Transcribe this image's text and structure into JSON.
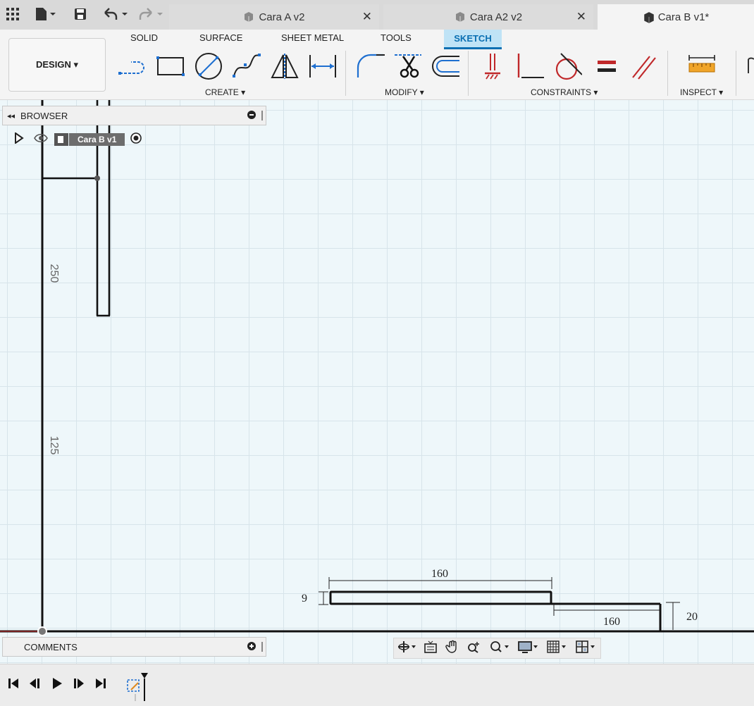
{
  "quick_access": {
    "grid_icon": "grid-icon",
    "file_icon": "file-icon",
    "save_icon": "save-icon",
    "undo_icon": "undo-icon",
    "redo_icon": "redo-icon"
  },
  "tabs": [
    {
      "label": "Cara A v2",
      "active": false
    },
    {
      "label": "Cara A2 v2",
      "active": false
    },
    {
      "label": "Cara B v1*",
      "active": true
    }
  ],
  "ribbon": {
    "tabs": [
      "SOLID",
      "SURFACE",
      "SHEET METAL",
      "TOOLS",
      "SKETCH"
    ],
    "active_tab": "SKETCH",
    "design_label": "DESIGN ▾",
    "groups": {
      "create": "CREATE ▾",
      "modify": "MODIFY ▾",
      "constraints": "CONSTRAINTS ▾",
      "inspect": "INSPECT ▾"
    }
  },
  "browser": {
    "title": "BROWSER",
    "component": "Cara B v1"
  },
  "comments": {
    "title": "COMMENTS"
  },
  "sketch_dimensions": {
    "vertical_1": "250",
    "vertical_2": "125",
    "top_length": "160",
    "thickness": "9",
    "bottom_length": "160",
    "step_height": "20"
  },
  "colors": {
    "active_tab_bg": "#bfe3f6",
    "active_tab_text": "#0a6fb2",
    "canvas_bg": "#eef7fa",
    "constraint_red": "#c0282a",
    "sketch_line": "#111111"
  }
}
